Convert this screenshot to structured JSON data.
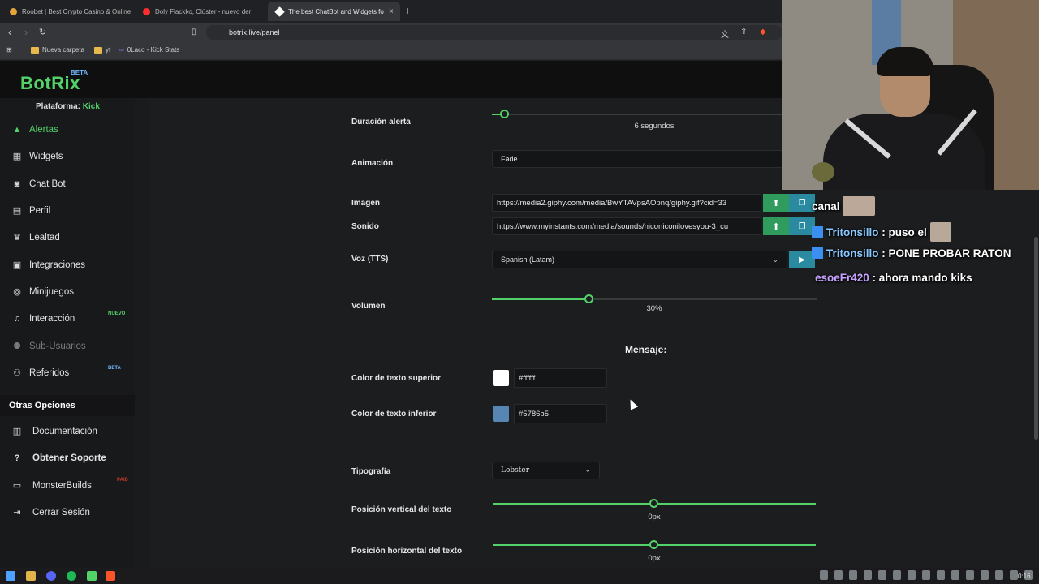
{
  "browser": {
    "tabs": [
      {
        "title": "Roobet | Best Crypto Casino & Online",
        "favicon_color": "#e5a33b"
      },
      {
        "title": "Doly Flackko, Clúster - nuevo der",
        "favicon_color": "#ff2e2e"
      },
      {
        "title": "The best ChatBot and Widgets fo",
        "favicon_color": "#ffffff",
        "active": true
      }
    ],
    "close_glyph": "×",
    "new_tab_glyph": "+",
    "url": "botrix.live/panel",
    "bookmarks": [
      {
        "label": "Nueva carpeta",
        "icon": "folder-icon"
      },
      {
        "label": "yt",
        "icon": "folder-icon"
      },
      {
        "label": "0Laco - Kick Stats",
        "icon": "kick-stats-icon"
      }
    ]
  },
  "app": {
    "logo": "BotRix",
    "logo_badge": "BETA",
    "platform_label": "Plataforma:",
    "platform_value": "Kick",
    "accent": "#54d26a"
  },
  "sidebar": {
    "items": [
      {
        "label": "Alertas",
        "icon": "warning-icon",
        "active": true
      },
      {
        "label": "Widgets",
        "icon": "grid-icon"
      },
      {
        "label": "Chat Bot",
        "icon": "robot-icon"
      },
      {
        "label": "Perfil",
        "icon": "id-card-icon"
      },
      {
        "label": "Lealtad",
        "icon": "trophy-icon"
      },
      {
        "label": "Integraciones",
        "icon": "integrations-icon"
      },
      {
        "label": "Minijuegos",
        "icon": "gamepad-icon"
      },
      {
        "label": "Interacción",
        "icon": "music-icon",
        "badge": "NUEVO",
        "badge_color": "#54d26a"
      },
      {
        "label": "Sub-Usuarios",
        "icon": "users-icon",
        "disabled": true
      },
      {
        "label": "Referidos",
        "icon": "people-icon",
        "badge": "BETA",
        "badge_color": "#6fb7ff"
      }
    ],
    "section_title": "Otras Opciones",
    "options": [
      {
        "label": "Documentación",
        "icon": "book-icon"
      },
      {
        "label": "Obtener Soporte",
        "icon": "question-icon",
        "bold": true
      },
      {
        "label": "MonsterBuilds",
        "icon": "laptop-icon",
        "badge": "PAID",
        "badge_color": "#c0392b"
      },
      {
        "label": "Cerrar Sesión",
        "icon": "logout-icon"
      }
    ]
  },
  "form": {
    "duracion": {
      "label": "Duración alerta",
      "value_text": "6 segundos",
      "fraction": 0.04
    },
    "animacion": {
      "label": "Animación",
      "value": "Fade"
    },
    "imagen": {
      "label": "Imagen",
      "value": "https://media2.giphy.com/media/BwYTAVpsAOpnq/giphy.gif?cid=33"
    },
    "sonido": {
      "label": "Sonido",
      "value": "https://www.myinstants.com/media/sounds/niconiconilovesyou-3_cu"
    },
    "voz": {
      "label": "Voz (TTS)",
      "value": "Spanish (Latam)"
    },
    "volumen": {
      "label": "Volumen",
      "value_text": "30%",
      "fraction": 0.3
    },
    "mensaje_title": "Mensaje:",
    "color_superior": {
      "label": "Color de texto superior",
      "value": "#ffffff",
      "swatch": "#ffffff"
    },
    "color_inferior": {
      "label": "Color de texto inferior",
      "value": "#5786b5",
      "swatch": "#5786b5"
    },
    "tipografia": {
      "label": "Tipografía",
      "value": "Lobster"
    },
    "pos_vertical": {
      "label": "Posición vertical del texto",
      "value_text": "0px",
      "fraction": 0.5
    },
    "pos_horizontal": {
      "label": "Posición horizontal del texto",
      "value_text": "0px",
      "fraction": 0.5
    }
  },
  "chat": {
    "lines": [
      {
        "user": "",
        "text": "canal",
        "emote": true
      },
      {
        "user": "Tritonsillo",
        "text": ": puso el",
        "emote": true
      },
      {
        "user": "Tritonsillo",
        "text": ": PONE PROBAR RATON"
      },
      {
        "user": "esoeFr420",
        "text": ": ahora mando kiks"
      }
    ]
  },
  "taskbar": {
    "clock": "0:16"
  }
}
